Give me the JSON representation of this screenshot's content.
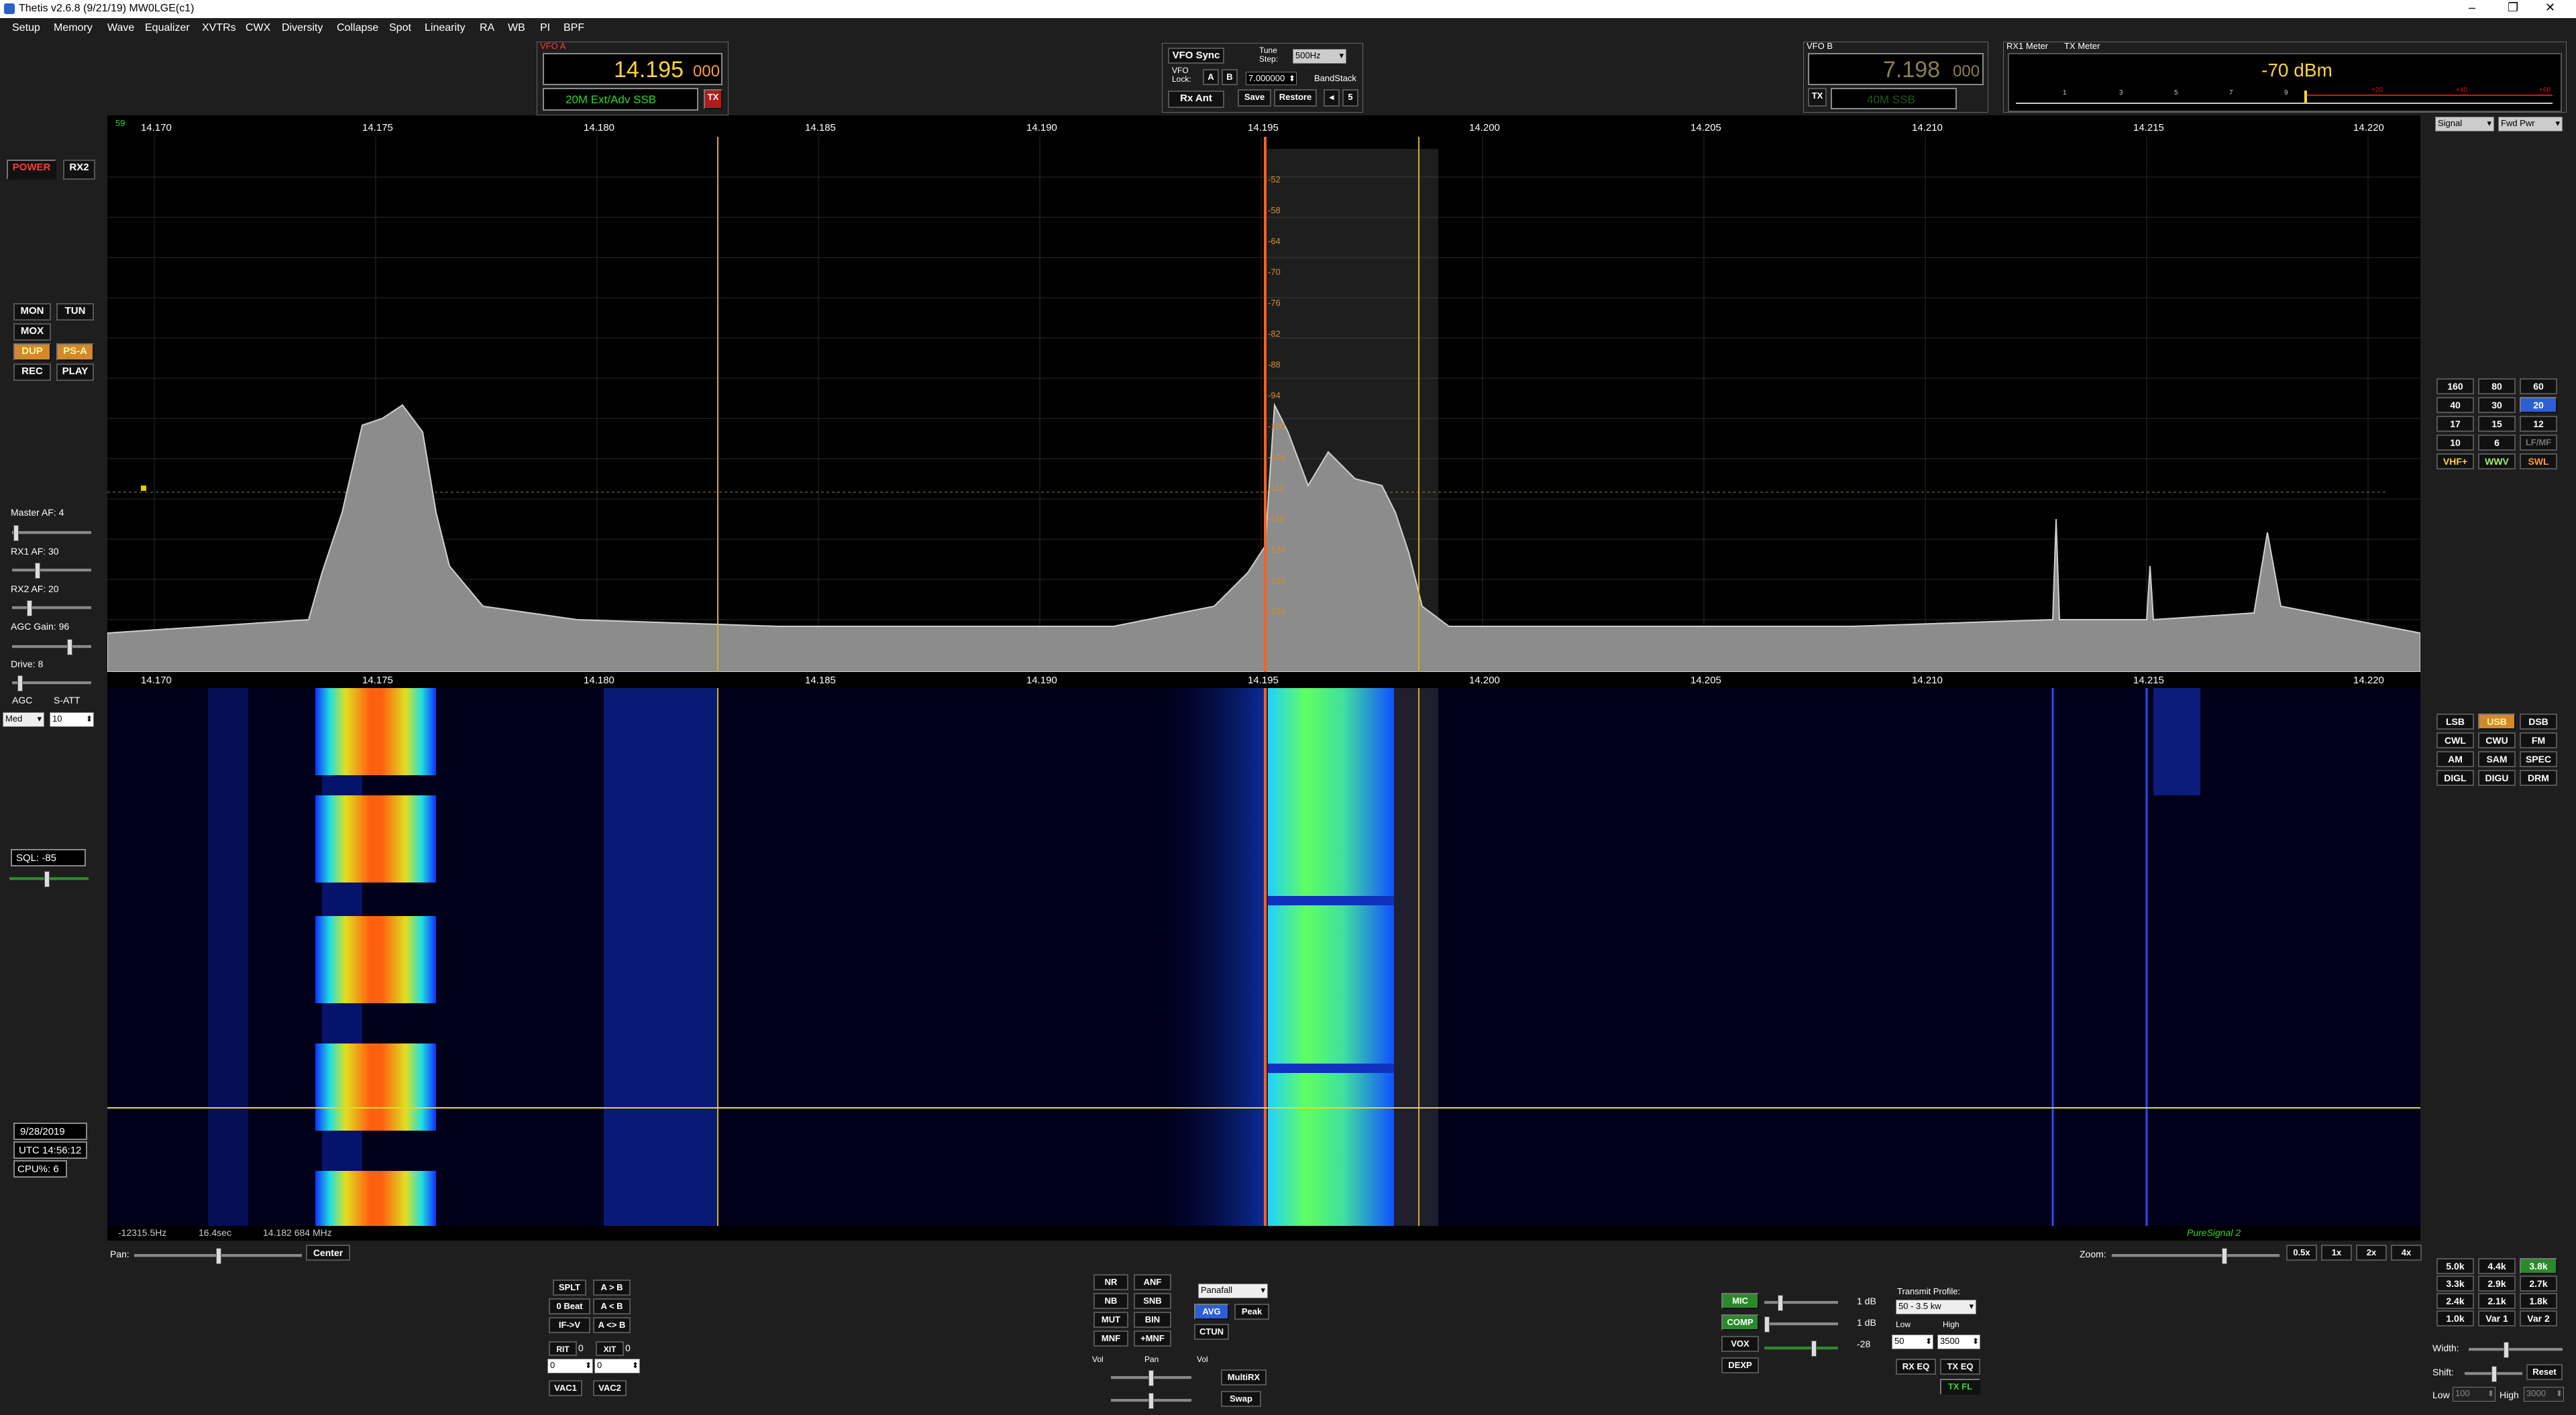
{
  "window": {
    "title": "Thetis v2.6.8 (9/21/19) MW0LGE(c1)",
    "controls": [
      "–",
      "❐",
      "✕"
    ]
  },
  "menu": [
    "Setup",
    "Memory",
    "Wave",
    "Equalizer",
    "XVTRs",
    "CWX",
    "Diversity",
    "Collapse",
    "Spot",
    "Linearity",
    "RA",
    "WB",
    "PI",
    "BPF"
  ],
  "vfo_a": {
    "label": "VFO A",
    "freq_main": "14.195",
    "freq_sub": "000",
    "band_label": "20M Ext/Adv SSB",
    "tx_badge": "TX"
  },
  "vfo_sync": {
    "sync_label": "VFO Sync",
    "lock_label": "VFO\nLock:",
    "a_label": "A",
    "b_label": "B",
    "tune_step_label": "Tune\nStep:",
    "tune_step_value": "500Hz",
    "freq_box": "7.000000",
    "bandstack_label": "BandStack",
    "rx_ant": "Rx Ant",
    "save": "Save",
    "restore": "Restore",
    "prev": "◂",
    "next": "5"
  },
  "vfo_b": {
    "label": "VFO B",
    "freq_main": "7.198",
    "freq_sub": "000",
    "band_label": "40M SSB",
    "tx_badge": "TX"
  },
  "meter": {
    "rx1_label": "RX1 Meter",
    "tx_label": "TX Meter",
    "reading": "-70 dBm",
    "scale": [
      "1",
      "3",
      "5",
      "7",
      "9",
      "+20",
      "+40",
      "+60"
    ],
    "rx_select": "Signal",
    "tx_select": "Fwd Pwr"
  },
  "left_panel": {
    "power": "POWER",
    "rx2": "RX2",
    "mon": "MON",
    "tun": "TUN",
    "mox": "MOX",
    "dup": "DUP",
    "psa": "PS-A",
    "rec": "REC",
    "play": "PLAY",
    "master_af": "Master AF:  4",
    "rx1_af": "RX1 AF:  30",
    "rx2_af": "RX2 AF:  20",
    "agc_gain": "AGC Gain:  96",
    "drive": "Drive:  8",
    "agc_label": "AGC",
    "satt_label": "S-ATT",
    "agc_value": "Med",
    "satt_value": "10",
    "sql": "SQL:  -85",
    "date": "9/28/2019",
    "utc": "UTC 14:56:12",
    "cpu": "CPU%:  6"
  },
  "display": {
    "top_left_num": "59",
    "freq_ticks": [
      "14.170",
      "14.175",
      "14.180",
      "14.185",
      "14.190",
      "14.195",
      "14.200",
      "14.205",
      "14.210",
      "14.215",
      "14.220"
    ],
    "db_ticks": [
      "-52",
      "-58",
      "-64",
      "-70",
      "-76",
      "-82",
      "-88",
      "-94",
      "-100",
      "-106",
      "-112",
      "-118",
      "-124",
      "-130",
      "-136"
    ],
    "status_left_a": "-12315.5Hz",
    "status_left_b": "16.4sec",
    "status_left_c": "14.182 684 MHz",
    "puresignal": "PureSignal 2",
    "pan_label": "Pan:",
    "center": "Center",
    "zoom_label": "Zoom:",
    "zoom_buttons": [
      "0.5x",
      "1x",
      "2x",
      "4x"
    ]
  },
  "bands": [
    "160",
    "80",
    "60",
    "40",
    "30",
    "20",
    "17",
    "15",
    "12",
    "10",
    "6",
    "LF/MF",
    "VHF+",
    "WWV",
    "SWL"
  ],
  "modes": [
    "LSB",
    "USB",
    "DSB",
    "CWL",
    "CWU",
    "FM",
    "AM",
    "SAM",
    "SPEC",
    "DIGL",
    "DIGU",
    "DRM"
  ],
  "filters": [
    "5.0k",
    "4.4k",
    "3.8k",
    "3.3k",
    "2.9k",
    "2.7k",
    "2.4k",
    "2.1k",
    "1.8k",
    "1.0k",
    "Var 1",
    "Var 2"
  ],
  "filter_ctrl": {
    "width": "Width:",
    "shift": "Shift:",
    "reset": "Reset",
    "low": "Low",
    "high": "High",
    "low_val": "100",
    "high_val": "3000"
  },
  "bottom_left": {
    "split": "SPLT",
    "a_to_b": "A > B",
    "zero_beat": "0 Beat",
    "a_lt_b": "A < B",
    "if_v": "IF->V",
    "a_swap_b": "A <> B",
    "rit": "RIT",
    "rit_val": "0",
    "xit": "XIT",
    "xit_val": "0",
    "rit_spin": "0",
    "xit_spin": "0",
    "vac1": "VAC1",
    "vac2": "VAC2"
  },
  "dsp": {
    "nr": "NR",
    "anf": "ANF",
    "nb": "NB",
    "snb": "SNB",
    "mut": "MUT",
    "bin": "BIN",
    "mnf": "MNF",
    "pmnf": "+MNF",
    "display_mode": "Panafall",
    "avg": "AVG",
    "peak": "Peak",
    "ctun": "CTUN",
    "vol_label": "Vol",
    "pan_label": "Pan",
    "vol2_label": "Vol",
    "multirx": "MultiRX",
    "swap": "Swap"
  },
  "tx": {
    "mic": "MIC",
    "mic_db": "1 dB",
    "comp": "COMP",
    "comp_db": "1 dB",
    "vox": "VOX",
    "vox_val": "-28",
    "dexp": "DEXP",
    "profile_label": "Transmit Profile:",
    "profile_value": "50 - 3.5 kw",
    "low_label": "Low",
    "high_label": "High",
    "low_val": "50",
    "high_val": "3500",
    "rx_eq": "RX EQ",
    "tx_eq": "TX EQ",
    "tx_fl": "TX FL"
  }
}
